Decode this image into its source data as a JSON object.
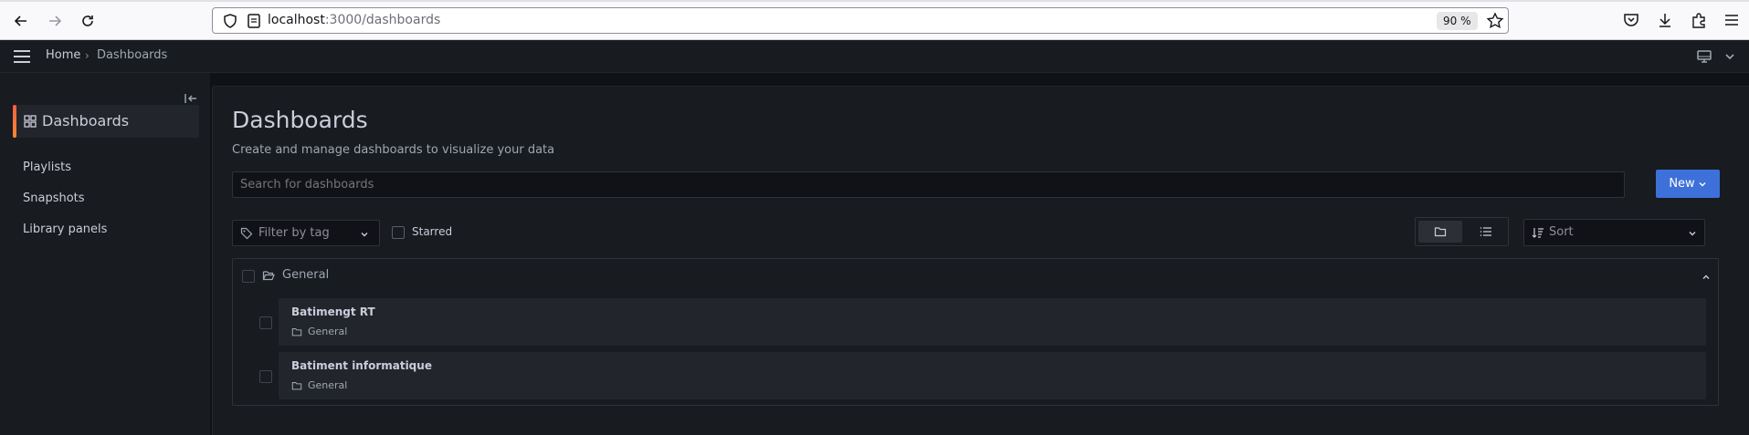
{
  "browser": {
    "url_host": "localhost",
    "url_path": ":3000/dashboards",
    "zoom": "90 %"
  },
  "topnav": {
    "breadcrumb_home": "Home",
    "breadcrumb_separator": "›",
    "breadcrumb_current": "Dashboards"
  },
  "sidebar": {
    "active": "Dashboards",
    "items": [
      {
        "label": "Playlists"
      },
      {
        "label": "Snapshots"
      },
      {
        "label": "Library panels"
      }
    ]
  },
  "main": {
    "title": "Dashboards",
    "subtitle": "Create and manage dashboards to visualize your data",
    "search_placeholder": "Search for dashboards",
    "new_button": "New",
    "filter_placeholder": "Filter by tag",
    "starred_label": "Starred",
    "sort_placeholder": "Sort",
    "folder": {
      "name": "General",
      "dashboards": [
        {
          "title": "Batimengt RT",
          "location": "General"
        },
        {
          "title": "Batiment informatique",
          "location": "General"
        }
      ]
    }
  },
  "colors": {
    "accent_orange": "#ff8833",
    "primary_blue": "#3d71d9",
    "background": "#111217",
    "panel": "#181b1f"
  }
}
